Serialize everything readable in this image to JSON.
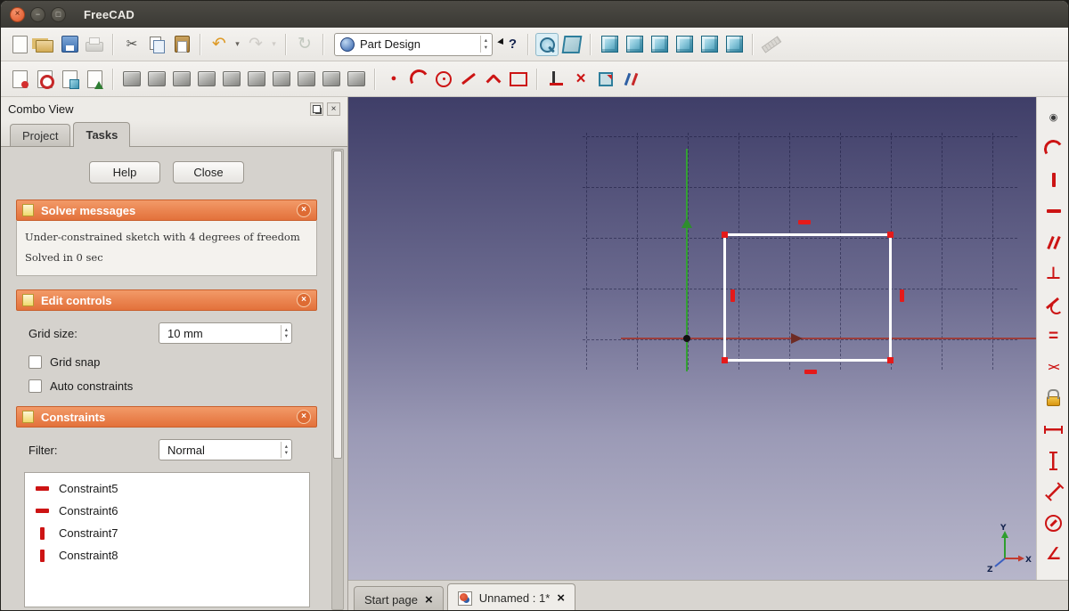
{
  "window": {
    "title": "FreeCAD",
    "controls": [
      {
        "name": "close-window-button",
        "glyph": "×"
      },
      {
        "name": "minimize-window-button",
        "glyph": "−"
      },
      {
        "name": "maximize-window-button",
        "glyph": "□"
      }
    ]
  },
  "glyphs": {
    "close": "×",
    "spin_up": "▴",
    "spin_down": "▾",
    "collapse": "×"
  },
  "toolbar_top": {
    "workbench_selector": {
      "value": "Part Design"
    },
    "items_left": [
      {
        "name": "new-document-icon",
        "cls": "ic-sheet",
        "interactable": true
      },
      {
        "name": "open-document-icon",
        "cls": "ic-folder",
        "interactable": true
      },
      {
        "name": "save-icon",
        "cls": "ic-save",
        "interactable": true
      },
      {
        "name": "print-icon",
        "cls": "ic-printer dim",
        "interactable": true
      },
      {
        "name": "toolbar-separator",
        "cls": "tb-sep",
        "interactable": false
      },
      {
        "name": "cut-icon",
        "glyph": "✂",
        "color": "#4A4A46",
        "interactable": true
      },
      {
        "name": "copy-icon",
        "cls": "ic-copy",
        "interactable": true
      },
      {
        "name": "paste-icon",
        "cls": "ic-paste",
        "interactable": true
      },
      {
        "name": "toolbar-separator",
        "cls": "tb-sep",
        "interactable": false
      },
      {
        "name": "undo-icon",
        "glyph": "↶",
        "color": "#DE9A26",
        "cls": "big",
        "interactable": true
      },
      {
        "name": "undo-dropdown-icon",
        "glyph": "▾",
        "color": "#66625C",
        "cls": "caret",
        "interactable": true
      },
      {
        "name": "redo-icon",
        "glyph": "↷",
        "color": "#A9A6A0",
        "cls": "big dim",
        "interactable": true
      },
      {
        "name": "redo-dropdown-icon",
        "glyph": "▾",
        "color": "#A9A6A0",
        "cls": "caret dim",
        "interactable": true
      },
      {
        "name": "toolbar-separator",
        "cls": "tb-sep",
        "interactable": false
      },
      {
        "name": "refresh-icon",
        "glyph": "↻",
        "color": "#8D9C8D",
        "cls": "big dim",
        "interactable": true
      },
      {
        "name": "toolbar-separator",
        "cls": "tb-sep",
        "interactable": false
      }
    ],
    "items_right": [
      {
        "name": "whatsthis-icon",
        "glyph": "?",
        "color": "#15244E",
        "cls": "ic-whatsthis",
        "interactable": true
      },
      {
        "name": "toolbar-separator",
        "cls": "tb-sep",
        "interactable": false
      },
      {
        "name": "fit-all-icon",
        "cls": "ic-zoom framed",
        "interactable": true
      },
      {
        "name": "axonometric-view-icon",
        "cls": "ic-cube-wire",
        "interactable": true
      },
      {
        "name": "toolbar-separator",
        "cls": "tb-sep",
        "interactable": false
      },
      {
        "name": "front-view-icon",
        "cls": "ic-cube",
        "interactable": true
      },
      {
        "name": "top-view-icon",
        "cls": "ic-cube",
        "interactable": true
      },
      {
        "name": "right-view-icon",
        "cls": "ic-cube",
        "interactable": true
      },
      {
        "name": "rear-view-icon",
        "cls": "ic-cube",
        "interactable": true
      },
      {
        "name": "bottom-view-icon",
        "cls": "ic-cube",
        "interactable": true
      },
      {
        "name": "left-view-icon",
        "cls": "ic-cube",
        "interactable": true
      },
      {
        "name": "toolbar-separator",
        "cls": "tb-sep",
        "interactable": false
      },
      {
        "name": "measure-distance-icon",
        "cls": "ic-measure dim",
        "interactable": true
      }
    ]
  },
  "toolbar_sketch": {
    "items": [
      {
        "name": "create-sketch-icon",
        "cls": "ic-sheet m-red",
        "interactable": true
      },
      {
        "name": "edit-sketch-icon",
        "cls": "ic-sheet m-edit",
        "interactable": true
      },
      {
        "name": "map-sketch-icon",
        "cls": "ic-sheet m-cube",
        "interactable": true
      },
      {
        "name": "leave-sketch-icon",
        "cls": "ic-sheet m-up",
        "interactable": true
      },
      {
        "name": "toolbar-separator",
        "cls": "tb-sep",
        "interactable": false
      },
      {
        "name": "pad-icon",
        "cls": "ic-shape",
        "interactable": true
      },
      {
        "name": "pocket-icon",
        "cls": "ic-shape",
        "interactable": true
      },
      {
        "name": "revolution-icon",
        "cls": "ic-shape",
        "interactable": true
      },
      {
        "name": "groove-icon",
        "cls": "ic-shape",
        "interactable": true
      },
      {
        "name": "fillet-icon",
        "cls": "ic-shape",
        "interactable": true
      },
      {
        "name": "chamfer-icon",
        "cls": "ic-shape",
        "interactable": true
      },
      {
        "name": "draft-icon",
        "cls": "ic-shape",
        "interactable": true
      },
      {
        "name": "thickness-icon",
        "cls": "ic-shape",
        "interactable": true
      },
      {
        "name": "mirrored-icon",
        "cls": "ic-shape",
        "interactable": true
      },
      {
        "name": "linear-pattern-icon",
        "cls": "ic-shape",
        "interactable": true
      },
      {
        "name": "toolbar-separator",
        "cls": "tb-sep",
        "interactable": false
      },
      {
        "name": "create-point-icon",
        "glyph": "●",
        "color": "#CC1414",
        "cls": "small",
        "interactable": true
      },
      {
        "name": "create-arc-icon",
        "cls": "ic-arc",
        "color": "#CC1414",
        "interactable": true
      },
      {
        "name": "create-circle-icon",
        "cls": "ic-circle",
        "color": "#CC1414",
        "interactable": true
      },
      {
        "name": "create-line-icon",
        "cls": "ic-line",
        "color": "#CC1414",
        "interactable": true
      },
      {
        "name": "create-polyline-icon",
        "cls": "ic-polyline",
        "color": "#CC1414",
        "interactable": true
      },
      {
        "name": "create-rectangle-icon",
        "cls": "ic-rect",
        "color": "#CC1414",
        "interactable": true
      },
      {
        "name": "toolbar-separator",
        "cls": "tb-sep",
        "interactable": false
      },
      {
        "name": "coordinate-axes-icon",
        "cls": "ic-axes",
        "color": "#CC1414",
        "interactable": true
      },
      {
        "name": "trim-edge-icon",
        "glyph": "×",
        "color": "#CC1414",
        "cls": "big bold",
        "interactable": true
      },
      {
        "name": "external-geometry-icon",
        "cls": "ic-ext",
        "interactable": true
      },
      {
        "name": "carbon-copy-icon",
        "cls": "ic-construction",
        "interactable": true
      }
    ]
  },
  "right_toolbar": {
    "items": [
      {
        "name": "constraint-coincident-icon",
        "glyph": "◉",
        "color": "#3A3A3A",
        "cls": "small",
        "interactable": true
      },
      {
        "name": "constraint-point-on-object-icon",
        "cls": "ic-arc",
        "color": "#CC1414",
        "interactable": true
      },
      {
        "name": "constraint-vertical-icon",
        "cls": "ic-vbar",
        "color": "#CC1414",
        "interactable": true
      },
      {
        "name": "constraint-horizontal-icon",
        "cls": "ic-hbar",
        "color": "#CC1414",
        "interactable": true
      },
      {
        "name": "constraint-parallel-icon",
        "cls": "ic-parallel",
        "color": "#CC1414",
        "interactable": true
      },
      {
        "name": "constraint-perpendicular-icon",
        "glyph": "⊥",
        "color": "#CC1414",
        "cls": "big bold",
        "interactable": true
      },
      {
        "name": "constraint-tangent-icon",
        "cls": "ic-tangent",
        "color": "#CC1414",
        "interactable": true
      },
      {
        "name": "constraint-equal-icon",
        "glyph": "=",
        "color": "#CC1414",
        "cls": "big bold",
        "interactable": true
      },
      {
        "name": "constraint-symmetric-icon",
        "glyph": "><",
        "color": "#CC1414",
        "cls": "sym",
        "interactable": true
      },
      {
        "name": "constraint-lock-icon",
        "cls": "ic-lock",
        "interactable": true
      },
      {
        "name": "constraint-horizontal-distance-icon",
        "cls": "ic-hdist",
        "color": "#CC1414",
        "interactable": true
      },
      {
        "name": "constraint-vertical-distance-icon",
        "cls": "ic-vdist",
        "color": "#CC1414",
        "interactable": true
      },
      {
        "name": "constraint-distance-icon",
        "cls": "ic-hdist diag",
        "color": "#CC1414",
        "interactable": true
      },
      {
        "name": "constraint-radius-icon",
        "cls": "ic-radius",
        "color": "#CC1414",
        "interactable": true
      },
      {
        "name": "constraint-angle-icon",
        "glyph": "∠",
        "color": "#CC1414",
        "cls": "big bold",
        "interactable": true
      }
    ]
  },
  "combo_view": {
    "title": "Combo View",
    "tabs": [
      {
        "label": "Project"
      },
      {
        "label": "Tasks"
      }
    ],
    "active_tab": "Tasks",
    "help_button": "Help",
    "close_button": "Close",
    "solver": {
      "title": "Solver messages",
      "lines": [
        "Under-constrained sketch with 4 degrees of freedom",
        "Solved in 0 sec"
      ]
    },
    "edit_controls": {
      "title": "Edit controls",
      "grid_size_label": "Grid size:",
      "grid_size_value": "10 mm",
      "grid_snap_label": "Grid snap",
      "grid_snap_checked": false,
      "auto_constraints_label": "Auto constraints",
      "auto_constraints_checked": false
    },
    "constraints": {
      "title": "Constraints",
      "filter_label": "Filter:",
      "filter_value": "Normal",
      "items": [
        {
          "name": "constraint-list-item",
          "label": "Constraint5",
          "cls": "horizontal",
          "interactable": true
        },
        {
          "name": "constraint-list-item",
          "label": "Constraint6",
          "cls": "horizontal",
          "interactable": true
        },
        {
          "name": "constraint-list-item",
          "label": "Constraint7",
          "cls": "vertical",
          "interactable": true
        },
        {
          "name": "constraint-list-item",
          "label": "Constraint8",
          "cls": "vertical",
          "interactable": true
        }
      ]
    }
  },
  "viewport": {
    "axis_indicator": {
      "x": "X",
      "y": "Y",
      "z": "Z"
    }
  },
  "bottom_tabs": [
    {
      "label": "Start page"
    },
    {
      "label": "Unnamed : 1*"
    }
  ],
  "colors": {
    "accent_orange": "#E3713B",
    "viewport_top": "#3F3E68",
    "viewport_bottom": "#B7B6CA",
    "sketch_line": "#FFFFFF",
    "constraint_red": "#CC1414",
    "axis_green": "#35A035",
    "axis_red": "#A03732",
    "view_cube_teal": "#3E93B0"
  }
}
